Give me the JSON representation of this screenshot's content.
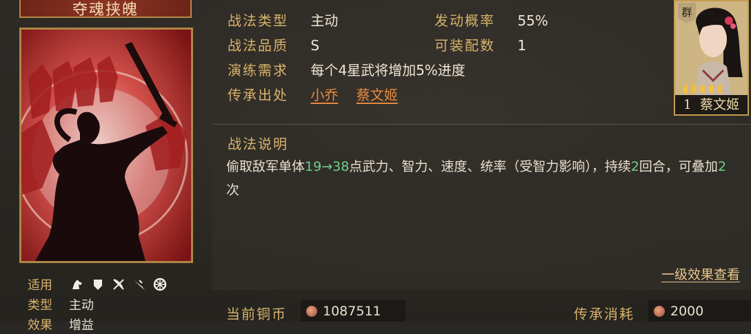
{
  "skill": {
    "name": "夺魂挟魄",
    "type_label": "战法类型",
    "type_value": "主动",
    "quality_label": "战法品质",
    "quality_value": "S",
    "train_label": "演练需求",
    "train_value": "每个4星武将增加5%进度",
    "source_label": "传承出处",
    "sources": [
      "小乔",
      "蔡文姬"
    ],
    "prob_label": "发动概率",
    "prob_value": "55%",
    "equip_label": "可装配数",
    "equip_value": "1"
  },
  "left_info": {
    "applicable_label": "适用",
    "applicable_icons": [
      "cavalry-icon",
      "shield-icon",
      "bow-icon",
      "spear-icon",
      "wheel-icon"
    ],
    "kind_label": "类型",
    "kind_value": "主动",
    "effect_label": "效果",
    "effect_value": "增益"
  },
  "portrait": {
    "faction": "群",
    "level": "1",
    "name": "蔡文姬",
    "stars": 5
  },
  "description": {
    "title": "战法说明",
    "text_pre": "偷取敌军单体",
    "range_a": "19",
    "arrow": "→",
    "range_b": "38",
    "text_mid": "点武力、智力、速度、统率（受智力影响），持续",
    "turns": "2",
    "text_mid2": "回合，可叠加",
    "stacks": "2",
    "text_end": "次",
    "effect_link": "一级效果查看"
  },
  "bottom": {
    "copper_label": "当前铜币",
    "copper_value": "1087511",
    "cost_label": "传承消耗",
    "cost_value": "2000"
  },
  "colors": {
    "gold_label": "#d8b36a",
    "link_orange": "#e88a3c",
    "highlight_green": "#6fcf8a",
    "card_red": "#b32a26"
  }
}
